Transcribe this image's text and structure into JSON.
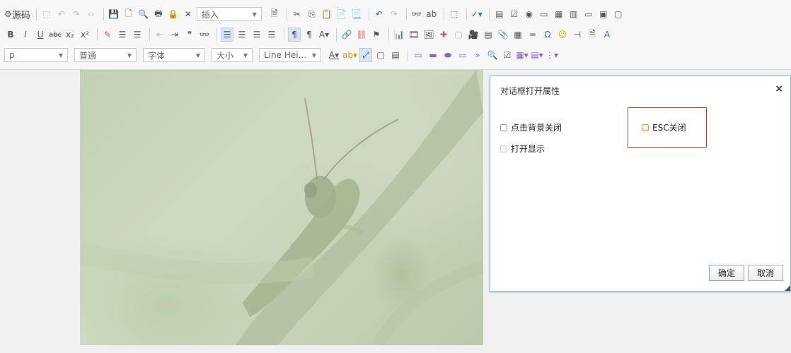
{
  "toolbar": {
    "row1": {
      "source_label": "源码",
      "insert_combo": "插入"
    },
    "row3": {
      "paragraph_combo": "p",
      "heading_combo": "普通",
      "font_combo": "字体",
      "size_combo": "大小",
      "lineheight_combo": "Line Hei..."
    }
  },
  "dialog": {
    "title": "对话框打开属性",
    "close_glyph": "×",
    "options": {
      "click_bg_close": "点击背景关闭",
      "esc_close": "ESC关闭",
      "open_show": "打开显示"
    },
    "ok_label": "确定",
    "cancel_label": "取消"
  },
  "colors": {
    "highlight_border": "#c0392b",
    "dialog_border": "#9bb3cf"
  }
}
